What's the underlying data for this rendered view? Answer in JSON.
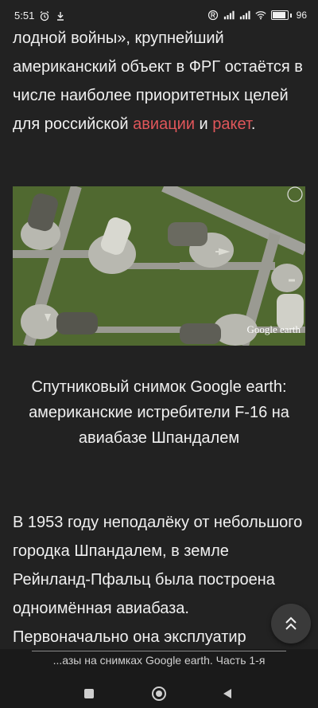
{
  "status": {
    "time": "5:51",
    "battery": "96",
    "battery_fraction": 0.96
  },
  "article": {
    "para1_text": "лодной войны», крупнейший американский объект в ФРГ остаётся в числе наиболее приоритетных целей для российской ",
    "link1": "авиации",
    "para1_mid": " и ",
    "link2": "ракет",
    "para1_end": ".",
    "image_watermark": "Google earth",
    "caption": "Спутниковый снимок Google earth: американские истребители F-16 на авиабазе Шпандалем",
    "para2_text": "В 1953 году неподалёку от небольшого городка Шпандалем, в земле Рейнланд-Пфальц была построена одноимённая авиабаза. Первоначально она эксплуатир"
  },
  "bottom": {
    "title": "...азы на снимках Google earth. Часть 1-я"
  },
  "colors": {
    "link": "#e0565a",
    "background": "#222222"
  }
}
